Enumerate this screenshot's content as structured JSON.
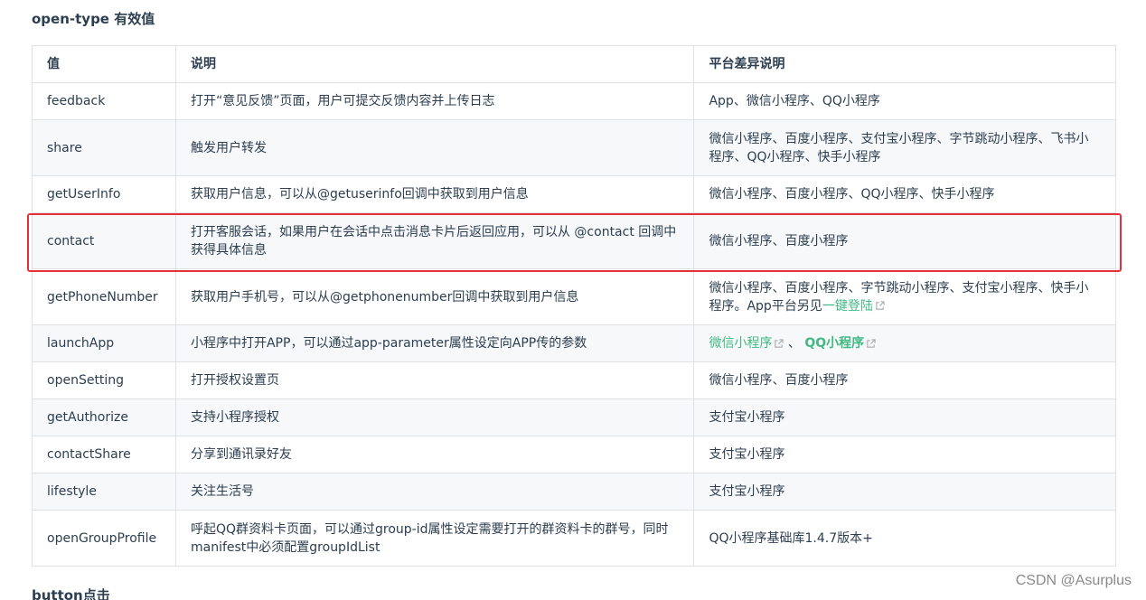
{
  "section_title": "open-type 有效值",
  "next_section_title": "button点击",
  "watermark": "CSDN @Asurplus",
  "colors": {
    "link": "#42b983",
    "highlight_border": "#e5303a",
    "row_alt_bg": "#f6f8fa",
    "border": "#dfe2e5"
  },
  "table": {
    "headers": [
      "值",
      "说明",
      "平台差异说明"
    ],
    "rows": [
      {
        "value": "feedback",
        "desc": "打开“意见反馈”页面，用户可提交反馈内容并上传日志",
        "platform": "App、微信小程序、QQ小程序"
      },
      {
        "value": "share",
        "desc": "触发用户转发",
        "platform": "微信小程序、百度小程序、支付宝小程序、字节跳动小程序、飞书小程序、QQ小程序、快手小程序"
      },
      {
        "value": "getUserInfo",
        "desc": "获取用户信息，可以从@getuserinfo回调中获取到用户信息",
        "platform": "微信小程序、百度小程序、QQ小程序、快手小程序"
      },
      {
        "value": "contact",
        "desc": "打开客服会话，如果用户在会话中点击消息卡片后返回应用，可以从 @contact 回调中获得具体信息",
        "platform": "微信小程序、百度小程序"
      },
      {
        "value": "getPhoneNumber",
        "desc": "获取用户手机号，可以从@getphonenumber回调中获取到用户信息",
        "platform_prefix": "微信小程序、百度小程序、字节跳动小程序、支付宝小程序、快手小程序。App平台另见",
        "platform_link": "一键登陆"
      },
      {
        "value": "launchApp",
        "desc": "小程序中打开APP，可以通过app-parameter属性设定向APP传的参数",
        "platform_link1": "微信小程序",
        "platform_sep": " 、",
        "platform_link2": "QQ小程序"
      },
      {
        "value": "openSetting",
        "desc": "打开授权设置页",
        "platform": "微信小程序、百度小程序"
      },
      {
        "value": "getAuthorize",
        "desc": "支持小程序授权",
        "platform": "支付宝小程序"
      },
      {
        "value": "contactShare",
        "desc": "分享到通讯录好友",
        "platform": "支付宝小程序"
      },
      {
        "value": "lifestyle",
        "desc": "关注生活号",
        "platform": "支付宝小程序"
      },
      {
        "value": "openGroupProfile",
        "desc": "呼起QQ群资料卡页面，可以通过group-id属性设定需要打开的群资料卡的群号，同时manifest中必须配置groupIdList",
        "platform": "QQ小程序基础库1.4.7版本+"
      }
    ]
  }
}
